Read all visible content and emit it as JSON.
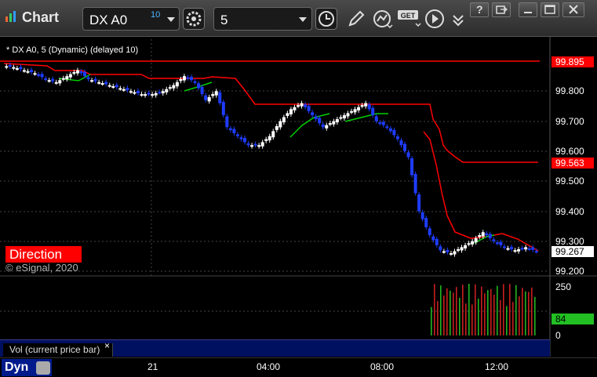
{
  "app": {
    "title": "Chart"
  },
  "toolbar": {
    "symbol": "DX A0",
    "symbol_badge": "10",
    "interval": "5",
    "icons": [
      "gear-icon",
      "clock-icon",
      "pencil-icon",
      "study-icon",
      "get-icon",
      "play-icon"
    ]
  },
  "window_buttons": [
    "help-icon",
    "restore-link-icon",
    "minimize-icon",
    "maximize-icon",
    "close-icon"
  ],
  "chart": {
    "title_line": "* DX A0, 5 (Dynamic) (delayed 10)",
    "direction_label": "Direction",
    "copyright": "© eSignal, 2020",
    "price_axis_ticks": [
      "99.800",
      "99.700",
      "99.600",
      "99.500",
      "99.400",
      "99.300",
      "99.200"
    ],
    "tags": {
      "upper_red": "99.895",
      "mid_red": "99.563",
      "last_price": "99.267"
    },
    "volume_ticks": [
      "250",
      "0"
    ],
    "volume_tag": "84",
    "volume_label": "Vol (current price bar)",
    "close_label": "×",
    "time_labels": [
      "21",
      "04:00",
      "08:00",
      "12:00"
    ],
    "mode_label": "Dyn",
    "colors": {
      "up_candle": "#ffffff",
      "down_candle": "#1e3cff",
      "ma_red": "#ff0000",
      "ma_green": "#00d000",
      "vol_red": "#c81e1e",
      "vol_green": "#22b422"
    }
  },
  "chart_data": {
    "type": "candlestick",
    "title": "* DX A0, 5 (Dynamic) (delayed 10)",
    "y_range": [
      99.2,
      99.9
    ],
    "x_labels": [
      "21",
      "04:00",
      "08:00",
      "12:00"
    ],
    "price_approx": [
      99.885,
      99.88,
      99.87,
      99.86,
      99.84,
      99.83,
      99.85,
      99.87,
      99.84,
      99.83,
      99.82,
      99.81,
      99.8,
      99.79,
      99.79,
      99.8,
      99.82,
      99.85,
      99.83,
      99.77,
      99.8,
      99.68,
      99.65,
      99.62,
      99.62,
      99.65,
      99.7,
      99.74,
      99.76,
      99.72,
      99.68,
      99.7,
      99.72,
      99.74,
      99.76,
      99.7,
      99.68,
      99.64,
      99.58,
      99.4,
      99.32,
      99.27,
      99.26,
      99.28,
      99.3,
      99.33,
      99.3,
      99.28,
      99.27,
      99.28,
      99.267
    ],
    "upper_level": 99.895,
    "lower_level": 99.563,
    "last": 99.267,
    "volume_max": 250,
    "volume_last": 84
  }
}
